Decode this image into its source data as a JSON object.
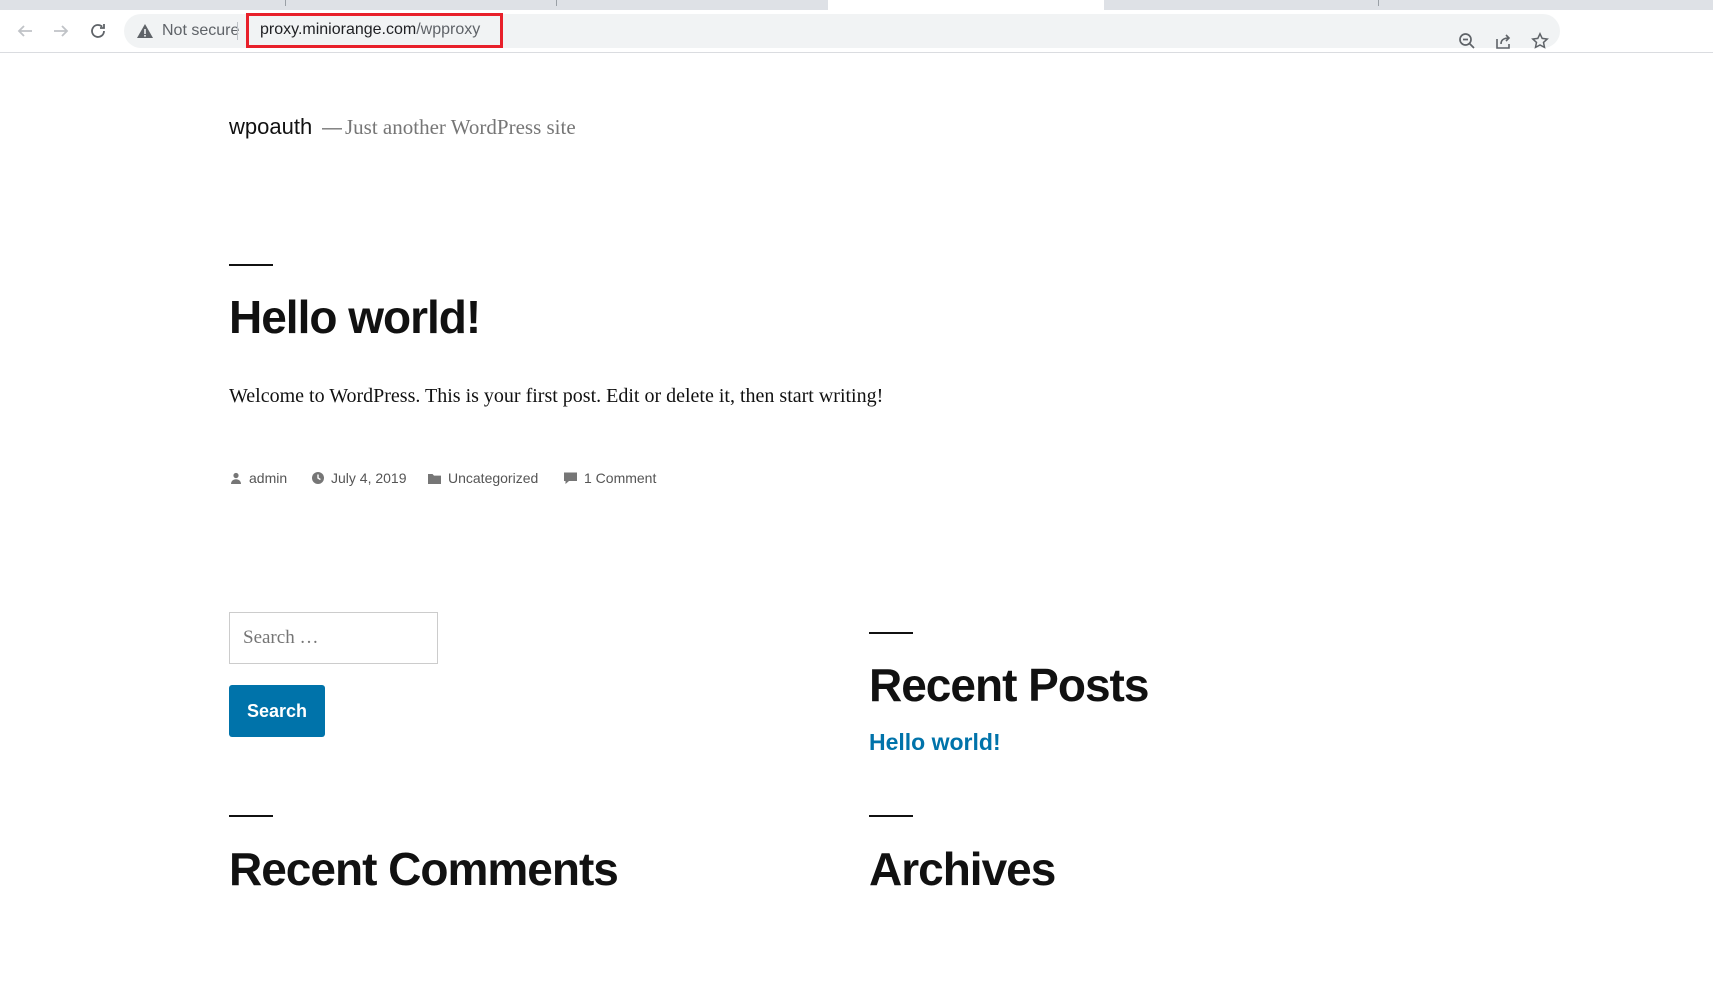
{
  "browser": {
    "security_label": "Not secure",
    "url_host": "proxy.miniorange.com",
    "url_path": "/wpproxy",
    "highlight_color": "#e8202a"
  },
  "site": {
    "title": "wpoauth",
    "separator": "—",
    "description": "Just another WordPress site"
  },
  "post": {
    "title": "Hello world!",
    "content": "Welcome to WordPress. This is your first post. Edit or delete it, then start writing!",
    "meta": {
      "author": "admin",
      "date": "July 4, 2019",
      "category": "Uncategorized",
      "comments": "1 Comment"
    }
  },
  "sidebar": {
    "search_placeholder": "Search …",
    "search_button": "Search",
    "recent_posts_title": "Recent Posts",
    "recent_posts": [
      "Hello world!"
    ],
    "recent_comments_title": "Recent Comments",
    "archives_title": "Archives"
  },
  "colors": {
    "accent": "#0073aa",
    "text": "#111111",
    "muted": "#767676"
  }
}
